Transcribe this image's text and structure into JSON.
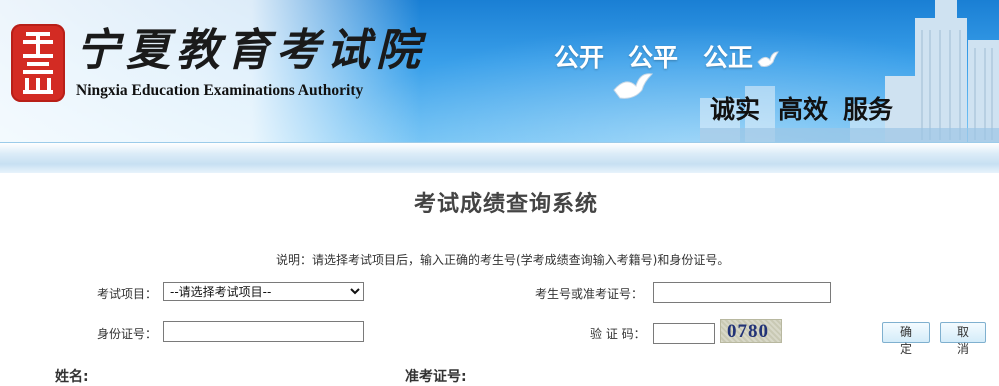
{
  "header": {
    "logo_cn": "宁夏教育考试院",
    "logo_en": "Ningxia Education Examinations Authority",
    "slogan_top": [
      "公开",
      "公平",
      "公正"
    ],
    "slogan_bottom": [
      "诚实",
      "高效",
      "服务"
    ]
  },
  "main": {
    "title": "考试成绩查询系统",
    "instruction": "说明：请选择考试项目后，输入正确的考生号(学考成绩查询输入考籍号)和身份证号。"
  },
  "form": {
    "exam_label": "考试项目：",
    "exam_selected": "--请选择考试项目--",
    "candidate_label": "考生号或准考证号：",
    "candidate_value": "",
    "id_label": "身份证号：",
    "id_value": "",
    "captcha_label": "验 证 码：",
    "captcha_value": "",
    "captcha_image_text": "0780",
    "confirm_label": "确 定",
    "cancel_label": "取 消"
  },
  "results": {
    "name_label": "姓名:",
    "ticket_label": "准考证号:"
  },
  "colors": {
    "banner_blue": "#2a90e0",
    "seal_red": "#d32b23",
    "title_gray": "#444444",
    "button_border": "#7fb0cf"
  }
}
